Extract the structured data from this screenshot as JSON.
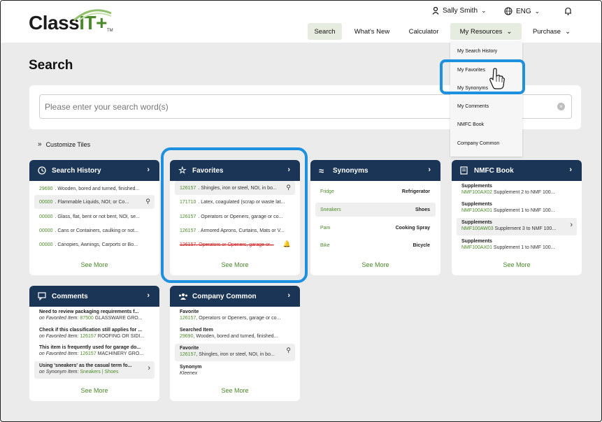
{
  "logo": {
    "text_main": "Class",
    "text_it": "IT+",
    "tm": "TM"
  },
  "user": {
    "name": "Sally Smith"
  },
  "language": {
    "code": "ENG"
  },
  "nav": {
    "search": "Search",
    "whats_new": "What's New",
    "calculator": "Calculator",
    "my_resources": "My Resources",
    "purchase": "Purchase"
  },
  "dropdown": [
    "My Search History",
    "My Favorites",
    "My Synonyms",
    "My Comments",
    "NMFC Book",
    "Company Common"
  ],
  "page": {
    "title": "Search"
  },
  "search": {
    "placeholder": "Please enter your search word(s)"
  },
  "customize": {
    "label": "Customize Tiles"
  },
  "tiles": {
    "search_history": {
      "title": "Search History",
      "rows": [
        {
          "code": "29690",
          "text": ". Wooden, bored and turned, finished..."
        },
        {
          "code": "00000",
          "text": ". Flammable Liquids, NOI; or Co..."
        },
        {
          "code": "00000",
          "text": ". Glass, flat, bent or not bent, NOI, se..."
        },
        {
          "code": "00000",
          "text": ". Cans or Containers, caulking or not..."
        },
        {
          "code": "00000",
          "text": ". Canopies, Awnings, Carports or Bo..."
        }
      ],
      "see_more": "See More"
    },
    "favorites": {
      "title": "Favorites",
      "rows": [
        {
          "code": "126157",
          "text": ". Shingles, iron or steel, NOI, in bo..."
        },
        {
          "code": "171710",
          "text": ". Latex, coagulated (scrap or waste lat..."
        },
        {
          "code": "126157",
          "text": ". Operators or Openers, garage or co..."
        },
        {
          "code": "126157",
          "text": ". Armored Aprons, Curtains, Mats or V..."
        },
        {
          "code": "126157",
          "text": ". Operators or Openers, garage or..."
        }
      ],
      "see_more": "See More"
    },
    "synonyms": {
      "title": "Synonyms",
      "rows": [
        {
          "left": "Fridge",
          "right": "Refrigerator"
        },
        {
          "left": "Sneakers",
          "right": "Shoes"
        },
        {
          "left": "Pam",
          "right": "Cooking Spray"
        },
        {
          "left": "Bike",
          "right": "Bicycle"
        }
      ],
      "see_more": "See More"
    },
    "nmfc": {
      "title": "NMFC Book",
      "rows": [
        {
          "title": "Supplements",
          "code": "NMF100AX02",
          "text": " Supplement 2 to NMF 100..."
        },
        {
          "title": "Supplements",
          "code": "NMF100AX01",
          "text": " Supplement 1 to NMF 100..."
        },
        {
          "title": "Supplements",
          "code": "NMF100AW03",
          "text": " Supplement 3 to NMF 100..."
        },
        {
          "title": "Supplements",
          "code": "NMF100AX01",
          "text": " Supplement 1 to NMF 100..."
        }
      ],
      "see_more": "See More"
    },
    "comments": {
      "title": "Comments",
      "rows": [
        {
          "title": "Need to review packaging requirements f...",
          "pre": "on Favorited Item: ",
          "code": "87500",
          "text": " GLASSWARE GRO..."
        },
        {
          "title": "Check if this classification still applies for ...",
          "pre": "on Favorited Item: ",
          "code": "126157",
          "text": " ROOFING OR SIDI..."
        },
        {
          "title": "This item is frequently used for garage do...",
          "pre": "on Favorited Item: ",
          "code": "126157",
          "text": " MACHINERY GRO..."
        },
        {
          "title": "Using 'sneakers' as the casual term fo...",
          "pre": "on Synonym Item: ",
          "code": "Sneakers | Shoes",
          "text": ""
        }
      ],
      "see_more": "See More"
    },
    "company_common": {
      "title": "Company Common",
      "rows": [
        {
          "title": "Favorite",
          "code": "126157",
          "text": ", Operators or Openers, garage or co..."
        },
        {
          "title": "Searched Item",
          "code": "29690",
          "text": ", Wooden, bored and turned, finished..."
        },
        {
          "title": "Favorite",
          "code": "126157",
          "text": ", Shingles, iron or steel, NOI, in bo..."
        },
        {
          "title": "Synonym",
          "code": "",
          "text": "Kleenex"
        }
      ],
      "see_more": "See More"
    }
  },
  "colors": {
    "navy": "#1b3556",
    "green": "#4a8a2a",
    "highlight": "#1e90e0",
    "alert": "#d42020"
  }
}
